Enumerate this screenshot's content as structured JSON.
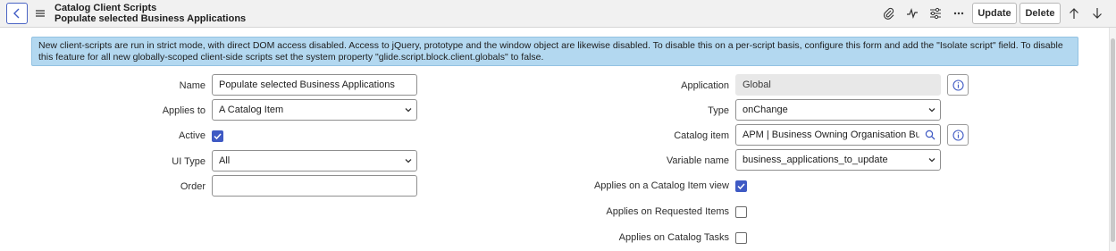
{
  "header": {
    "title_line1": "Catalog Client Scripts",
    "title_line2": "Populate selected Business Applications",
    "icons": [
      "chevron-left-icon",
      "hamburger-menu-icon",
      "paperclip-icon",
      "activity-icon",
      "settings-sliders-icon",
      "more-icon",
      "arrow-up-icon",
      "arrow-down-icon"
    ],
    "update_label": "Update",
    "delete_label": "Delete"
  },
  "banner": {
    "text": "New client-scripts are run in strict mode, with direct DOM access disabled. Access to jQuery, prototype and the window object are likewise disabled. To disable this on a per-script basis, configure this form and add the \"Isolate script\" field. To disable this feature for all new globally-scoped client-side scripts set the system property \"glide.script.block.client.globals\" to false."
  },
  "form": {
    "name_label": "Name",
    "name_value": "Populate selected Business Applications",
    "applies_to_label": "Applies to",
    "applies_to_value": "A Catalog Item",
    "active_label": "Active",
    "active_checked": true,
    "ui_type_label": "UI Type",
    "ui_type_value": "All",
    "order_label": "Order",
    "order_value": "",
    "application_label": "Application",
    "application_value": "Global",
    "type_label": "Type",
    "type_value": "onChange",
    "catalog_item_label": "Catalog item",
    "catalog_item_value": "APM | Business Owning Organisation Bulk U",
    "variable_name_label": "Variable name",
    "variable_name_value": "business_applications_to_update",
    "applies_catalog_view_label": "Applies on a Catalog Item view",
    "applies_catalog_view_checked": true,
    "applies_requested_label": "Applies on Requested Items",
    "applies_requested_checked": false,
    "applies_tasks_label": "Applies on Catalog Tasks",
    "applies_tasks_checked": false
  },
  "colors": {
    "accent": "#3f5ac4",
    "banner_bg": "#b3d8f0",
    "header_bg": "#f1f1f1"
  }
}
